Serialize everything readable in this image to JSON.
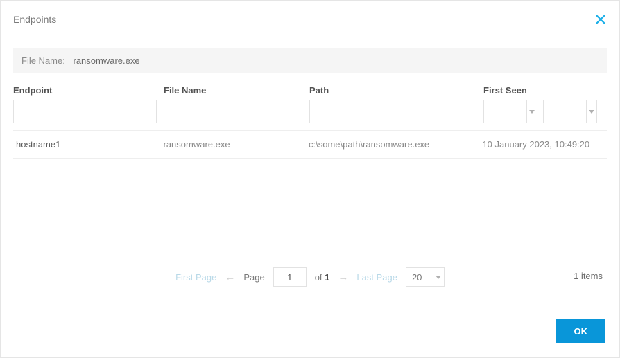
{
  "dialog": {
    "title": "Endpoints",
    "file_name_label": "File Name:",
    "file_name_value": "ransomware.exe"
  },
  "columns": {
    "endpoint": "Endpoint",
    "file_name": "File Name",
    "path": "Path",
    "first_seen": "First Seen"
  },
  "filters": {
    "endpoint": "",
    "file_name": "",
    "path": "",
    "first_seen_from": "",
    "first_seen_to": ""
  },
  "rows": [
    {
      "endpoint": "hostname1",
      "file_name": "ransomware.exe",
      "path": "c:\\some\\path\\ransomware.exe",
      "first_seen": "10 January 2023, 10:49:20"
    }
  ],
  "pager": {
    "first_page": "First Page",
    "page_label": "Page",
    "page_value": "1",
    "of_label": "of",
    "total_pages": "1",
    "last_page": "Last Page",
    "page_size": "20",
    "items_text": "1 items"
  },
  "buttons": {
    "ok": "OK"
  }
}
